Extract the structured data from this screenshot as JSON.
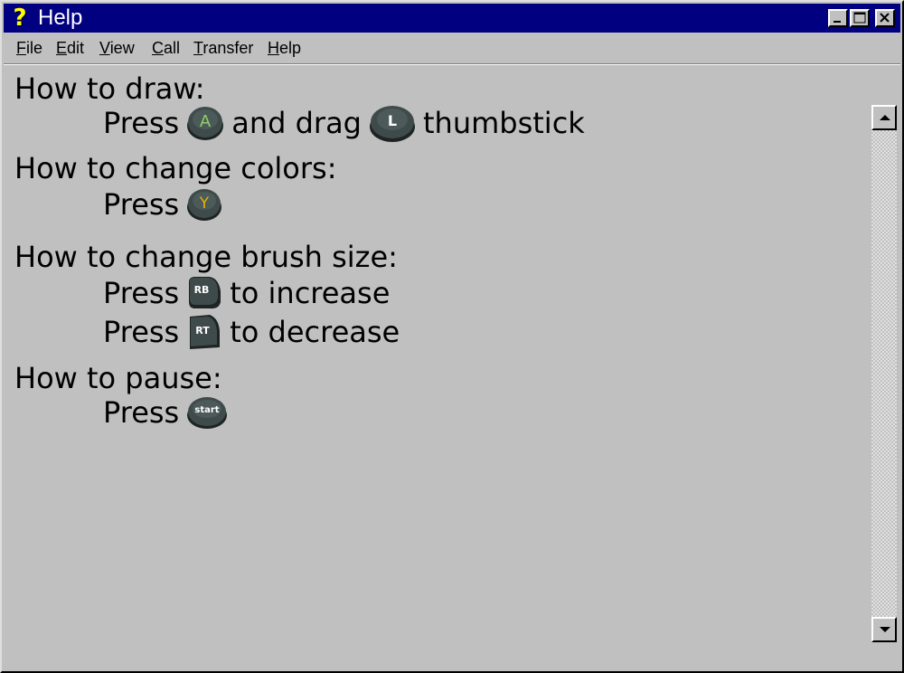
{
  "window": {
    "title": "Help",
    "icon": "help-question-icon",
    "controls": [
      "minimize",
      "maximize",
      "close"
    ]
  },
  "menu": {
    "items": [
      {
        "label": "File",
        "accel": "F"
      },
      {
        "label": "Edit",
        "accel": "E"
      },
      {
        "label": "View",
        "accel": "V"
      },
      {
        "label": "Call",
        "accel": "C"
      },
      {
        "label": "Transfer",
        "accel": "T"
      },
      {
        "label": "Help",
        "accel": "H"
      }
    ]
  },
  "help": {
    "draw": {
      "heading": "How to draw:",
      "press": "Press",
      "button_a": "A",
      "and_drag": "and drag",
      "button_l": "L",
      "thumbstick": "thumbstick"
    },
    "colors": {
      "heading": "How to change colors:",
      "press": "Press",
      "button_y": "Y"
    },
    "brush": {
      "heading": "How to change brush size:",
      "press1": "Press",
      "button_rb": "RB",
      "increase": "to increase",
      "press2": "Press",
      "button_rt": "RT",
      "decrease": "to decrease"
    },
    "pause": {
      "heading": "How to pause:",
      "press": "Press",
      "button_start": "start"
    }
  },
  "colors": {
    "titlebar": "#000080",
    "face": "#c0c0c0",
    "button_body": "#3f4a4a",
    "a_letter": "#8fd06a",
    "y_letter": "#e8b000"
  }
}
